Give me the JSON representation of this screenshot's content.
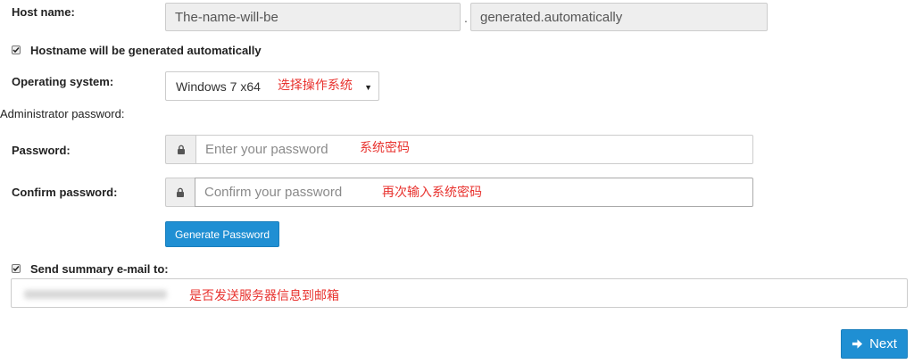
{
  "host": {
    "label": "Host name:",
    "name_value": "The-name-will-be",
    "separator": ".",
    "domain_value": "generated.automatically"
  },
  "auto_hostname": {
    "checked": true,
    "label": "Hostname will be generated automatically"
  },
  "os": {
    "label": "Operating system:",
    "selected": "Windows 7 x64",
    "note": "选择操作系统"
  },
  "admin_section": {
    "label": "Administrator password:"
  },
  "password": {
    "label": "Password:",
    "placeholder": "Enter your password",
    "note": "系统密码",
    "icon": "lock-icon"
  },
  "confirm_password": {
    "label": "Confirm password:",
    "placeholder": "Confirm your password",
    "note": "再次输入系统密码",
    "icon": "lock-icon"
  },
  "generate_button": {
    "label": "Generate Password",
    "color": "#1f8fd3"
  },
  "summary_email": {
    "checked": true,
    "label": "Send summary e-mail to:",
    "note": "是否发送服务器信息到邮箱"
  },
  "next_button": {
    "label": "Next",
    "icon": "arrow-right-icon",
    "color": "#1f8fd3"
  },
  "annotation_color": "#e8322e"
}
